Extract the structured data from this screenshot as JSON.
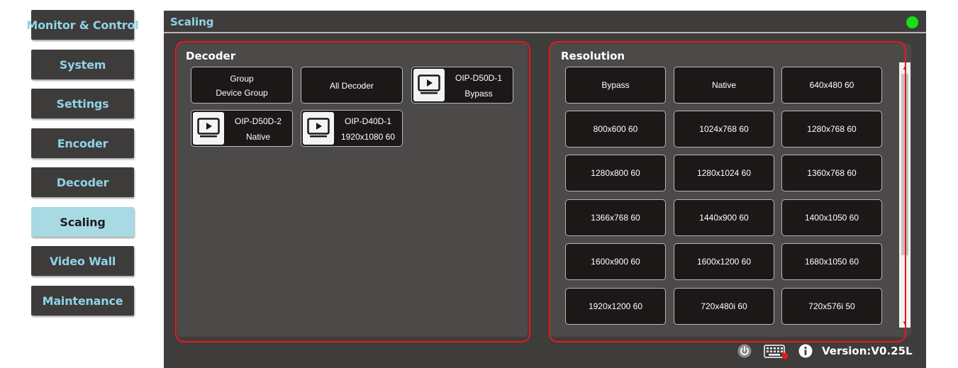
{
  "sidebar": {
    "items": [
      {
        "label": "Monitor & Control"
      },
      {
        "label": "System"
      },
      {
        "label": "Settings"
      },
      {
        "label": "Encoder"
      },
      {
        "label": "Decoder"
      },
      {
        "label": "Scaling",
        "active": true
      },
      {
        "label": "Video Wall"
      },
      {
        "label": "Maintenance"
      }
    ]
  },
  "header": {
    "title": "Scaling",
    "status_color": "#16e016"
  },
  "decoder_panel": {
    "title": "Decoder",
    "items": [
      {
        "line1": "Group",
        "line2": "Device Group",
        "icon": null
      },
      {
        "line1": "All Decoder",
        "icon": null
      },
      {
        "line1": "OIP-D50D-1",
        "line2": "Bypass",
        "icon": "monitor-icon"
      },
      {
        "line1": "OIP-D50D-2",
        "line2": "Native",
        "icon": "monitor-icon"
      },
      {
        "line1": "OIP-D40D-1",
        "line2": "1920x1080 60",
        "icon": "monitor-icon"
      }
    ]
  },
  "resolution_panel": {
    "title": "Resolution",
    "options": [
      "Bypass",
      "Native",
      "640x480 60",
      "800x600 60",
      "1024x768 60",
      "1280x768 60",
      "1280x800 60",
      "1280x1024 60",
      "1360x768 60",
      "1366x768 60",
      "1440x900 60",
      "1400x1050 60",
      "1600x900 60",
      "1600x1200 60",
      "1680x1050 60",
      "1920x1200 60",
      "720x480i 60",
      "720x576i 50"
    ]
  },
  "footer": {
    "icons": [
      "power-icon",
      "keyboard-icon",
      "info-icon"
    ],
    "version": "Version:V0.25L"
  },
  "colors": {
    "accent": "#8fd3e6",
    "active_nav": "#a8dae4",
    "highlight": "#e8191d",
    "panel_bg": "#3f3c3c"
  }
}
